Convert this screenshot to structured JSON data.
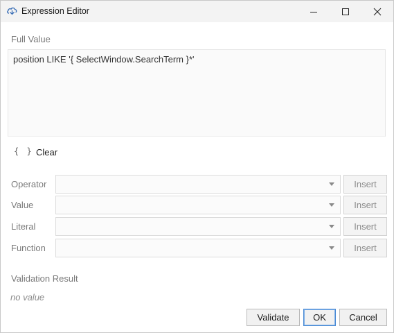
{
  "window": {
    "title": "Expression Editor",
    "icon": "cloud-app-icon"
  },
  "full_value": {
    "label": "Full Value",
    "value": "position LIKE '{ SelectWindow.SearchTerm }*'"
  },
  "toolbar": {
    "braces_glyph": "{ }",
    "clear_label": "Clear"
  },
  "rows": [
    {
      "label": "Operator",
      "value": "",
      "insert_label": "Insert"
    },
    {
      "label": "Value",
      "value": "",
      "insert_label": "Insert"
    },
    {
      "label": "Literal",
      "value": "",
      "insert_label": "Insert"
    },
    {
      "label": "Function",
      "value": "",
      "insert_label": "Insert"
    }
  ],
  "validation": {
    "label": "Validation Result",
    "result": "no value"
  },
  "buttons": {
    "validate": "Validate",
    "ok": "OK",
    "cancel": "Cancel"
  },
  "colors": {
    "accent_focus": "#4a8ad4",
    "muted_text": "#7a7a7a"
  }
}
